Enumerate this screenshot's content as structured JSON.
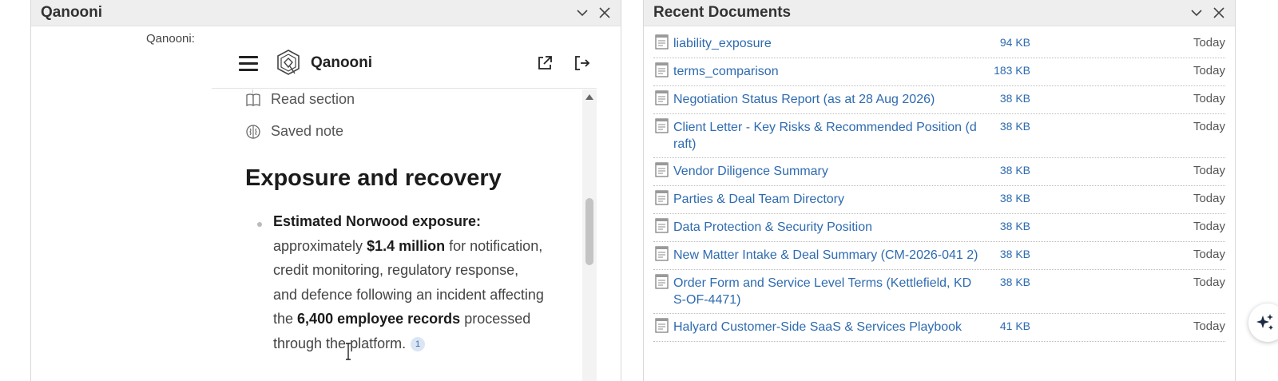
{
  "left_panel": {
    "title": "Qanooni",
    "label": "Qanooni:",
    "widget": {
      "brand": "Qanooni",
      "steps": [
        {
          "label": "Read section",
          "icon": "book-icon"
        },
        {
          "label": "Saved note",
          "icon": "brain-icon"
        }
      ],
      "heading": "Exposure and recovery",
      "bullet": {
        "lead": "Estimated Norwood exposure:",
        "t1": "approximately",
        "amount": "$1.4 million",
        "t2": "for notification, credit monitoring, regulatory response, and defence following an incident affecting the",
        "records": "6,400 employee records",
        "t3": "processed through the platform.",
        "citation": "1"
      }
    }
  },
  "right_panel": {
    "title": "Recent Documents",
    "documents": [
      {
        "name": "liability_exposure",
        "size": "94 KB",
        "date": "Today"
      },
      {
        "name": "terms_comparison",
        "size": "183 KB",
        "date": "Today"
      },
      {
        "name": "Negotiation Status Report (as at 28 Aug 2026)",
        "size": "38 KB",
        "date": "Today"
      },
      {
        "name": "Client Letter - Key Risks & Recommended Position (d raft)",
        "size": "38 KB",
        "date": "Today"
      },
      {
        "name": "Vendor Diligence Summary",
        "size": "38 KB",
        "date": "Today"
      },
      {
        "name": "Parties & Deal Team Directory",
        "size": "38 KB",
        "date": "Today"
      },
      {
        "name": "Data Protection & Security Position",
        "size": "38 KB",
        "date": "Today"
      },
      {
        "name": "New Matter Intake & Deal Summary (CM-2026-041 2)",
        "size": "38 KB",
        "date": "Today"
      },
      {
        "name": "Order Form and Service Level Terms (Kettlefield, KD S-OF-4471)",
        "size": "38 KB",
        "date": "Today"
      },
      {
        "name": "Halyard Customer-Side SaaS & Services Playbook",
        "size": "41 KB",
        "date": "Today"
      }
    ]
  },
  "colors": {
    "link": "#2e6bb0",
    "header_bg": "#eeeeee"
  }
}
